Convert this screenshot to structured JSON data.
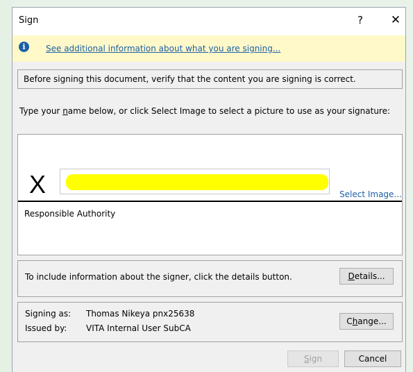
{
  "window": {
    "title": "Sign",
    "help_label": "?",
    "close_label": "✕"
  },
  "info_bar": {
    "icon": "i",
    "link_text": "See additional information about what you are signing..."
  },
  "verify_notice": "Before signing this document, verify that the content you are signing is correct.",
  "type_name_label": {
    "pre": "Type your ",
    "accel": "n",
    "post": "ame below, or click Select Image to select a picture to use as your signature:"
  },
  "signature": {
    "x_mark": "X",
    "name_value": "",
    "highlight_color": "#ffff00",
    "select_image_link": "Select Image...",
    "role_text": "Responsible Authority"
  },
  "details_section": {
    "text": "To include information about the signer, click the details button.",
    "button": {
      "accel": "D",
      "rest": "etails..."
    }
  },
  "signer": {
    "signing_as_label": "Signing as:",
    "signing_as_value": "Thomas Nikeya pnx25638",
    "issued_by_label": "Issued by:",
    "issued_by_value": "VITA Internal User SubCA",
    "change_button": {
      "pre": "C",
      "accel": "h",
      "post": "ange..."
    }
  },
  "footer": {
    "sign_button": {
      "accel": "S",
      "rest": "ign"
    },
    "cancel_label": "Cancel"
  },
  "colors": {
    "link": "#1d5fa6",
    "info_bar_bg": "#fff9c9",
    "info_icon": "#1a5fa8"
  }
}
